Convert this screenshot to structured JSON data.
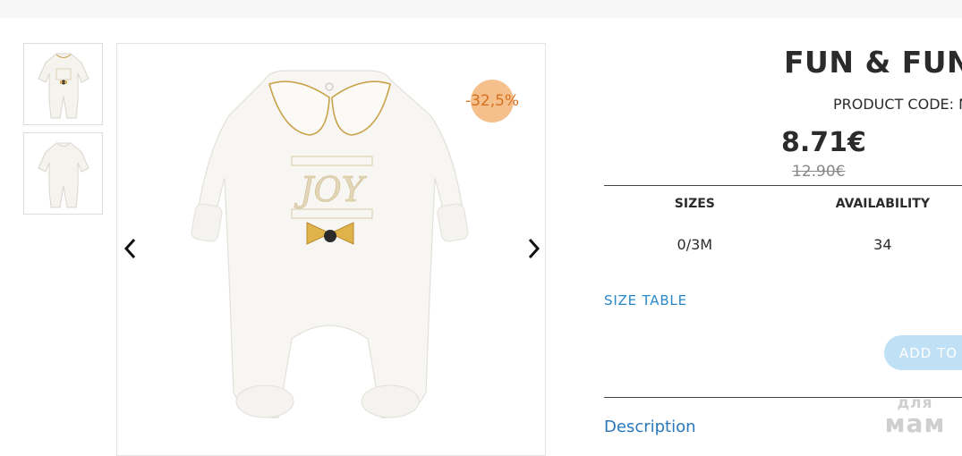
{
  "product": {
    "title": "FUN & FUN -",
    "code_label": "PRODUCT CODE: N",
    "price": "8.71€",
    "old_price": "12.90€",
    "discount": "-32,5%"
  },
  "availability_table": {
    "headers": [
      "SIZES",
      "AVAILABILITY"
    ],
    "rows": [
      [
        "0/3M",
        "34"
      ]
    ]
  },
  "links": {
    "size_table": "SIZE TABLE",
    "add_to_cart": "ADD TO C",
    "description": "Description"
  },
  "image": {
    "embroidery_text": "JOY"
  },
  "watermark": {
    "line1": "для",
    "line2": "мам"
  },
  "colors": {
    "badge_bg": "#f6c08d",
    "badge_text": "#d4701f",
    "link": "#2a88c9",
    "button_bg": "#bfe0f5"
  },
  "icons": [
    "chevron-left-icon",
    "chevron-right-icon"
  ]
}
